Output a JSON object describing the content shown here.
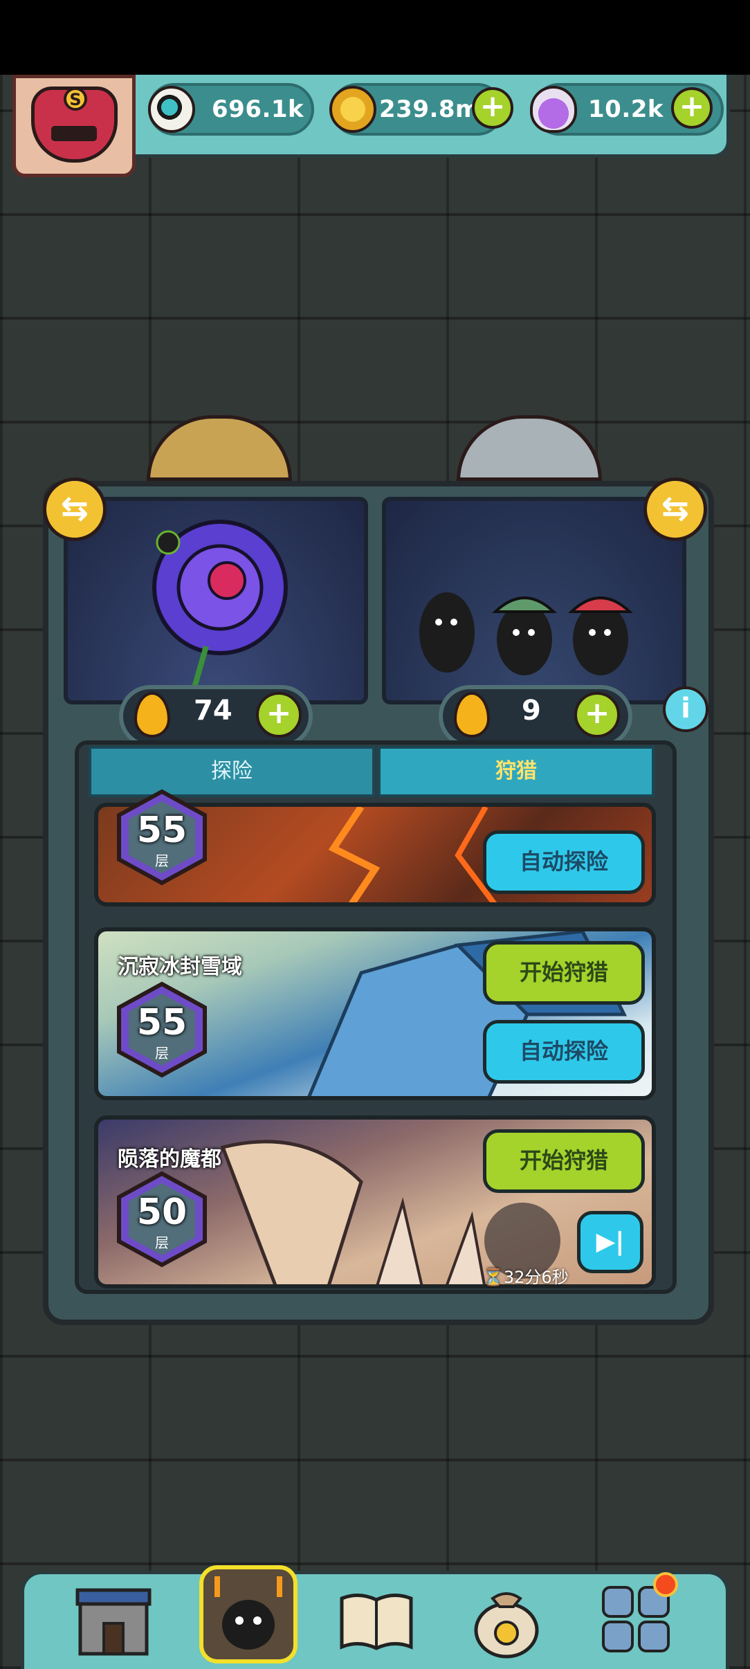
{
  "resources": {
    "eyeball": {
      "value": "696.1k",
      "icon": "eyeball-icon"
    },
    "coins": {
      "value": "239.8m",
      "icon": "coin-icon"
    },
    "potion": {
      "value": "10.2k",
      "icon": "potion-icon"
    }
  },
  "stats": {
    "left_drop": "74",
    "right_drop": "9"
  },
  "tabs": [
    {
      "label": "探险",
      "active": false
    },
    {
      "label": "狩猎",
      "active": true
    }
  ],
  "cards": [
    {
      "title": "",
      "level": "55",
      "level_unit": "层",
      "auto_label": "自动探险"
    },
    {
      "title": "沉寂冰封雪域",
      "level": "55",
      "level_unit": "层",
      "hunt_label": "开始狩猎",
      "auto_label": "自动探险"
    },
    {
      "title": "陨落的魔都",
      "level": "50",
      "level_unit": "层",
      "hunt_label": "开始狩猎",
      "timer": "32分6秒"
    }
  ],
  "colors": {
    "accent_green": "#a5d22b",
    "accent_blue": "#2ec9ea",
    "gold": "#f3c233",
    "teal_bar": "#6fc6c2"
  },
  "bottom_nav": [
    {
      "name": "shop-building-icon"
    },
    {
      "name": "monster-portrait-icon",
      "active": true
    },
    {
      "name": "book-icon"
    },
    {
      "name": "money-bag-icon"
    },
    {
      "name": "grid-menu-icon",
      "notification": true
    }
  ]
}
